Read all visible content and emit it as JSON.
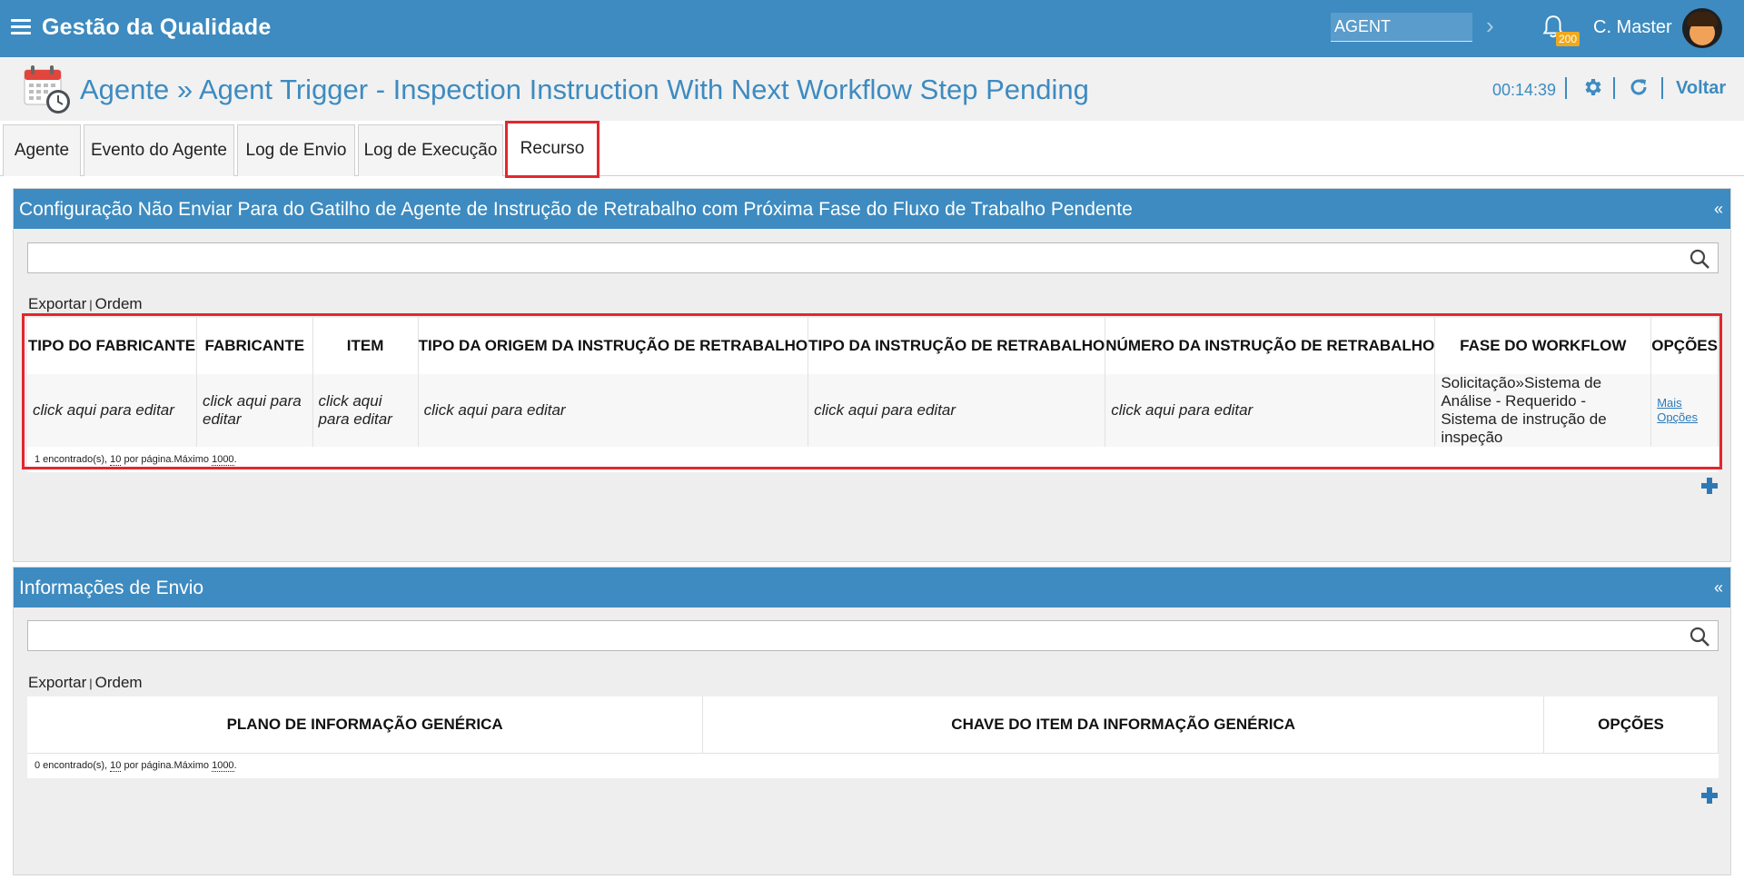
{
  "topbar": {
    "title": "Gestão da Qualidade",
    "module_value": "AGENT",
    "notification_count": "200",
    "user_name": "C. Master"
  },
  "title_row": {
    "page_title": "Agente » Agent Trigger - Inspection Instruction With Next Workflow Step Pending",
    "timer": "00:14:39",
    "back_label": "Voltar"
  },
  "tabs": [
    {
      "label": "Agente"
    },
    {
      "label": "Evento do Agente"
    },
    {
      "label": "Log de Envio"
    },
    {
      "label": "Log de Execução"
    },
    {
      "label": "Recurso",
      "active": true
    }
  ],
  "panel1": {
    "title": "Configuração Não Enviar Para do Gatilho de Agente de Instrução de Retrabalho com Próxima Fase do Fluxo de Trabalho Pendente",
    "collapse": "«",
    "search_value": "",
    "export_label": "Exportar",
    "order_label": "Ordem",
    "columns": [
      "TIPO DO FABRICANTE",
      "FABRICANTE",
      "ITEM",
      "TIPO DA ORIGEM DA INSTRUÇÃO DE RETRABALHO",
      "TIPO DA INSTRUÇÃO DE RETRABALHO",
      "NÚMERO DA INSTRUÇÃO DE RETRABALHO",
      "FASE DO WORKFLOW",
      "OPÇÕES"
    ],
    "row": {
      "tipo_fabricante": "click aqui para editar",
      "fabricante": "click aqui para editar",
      "item": "click aqui para editar",
      "tipo_origem": "click aqui para editar",
      "tipo_instrucao": "click aqui para editar",
      "numero_instrucao": "click aqui para editar",
      "fase_workflow": "Solicitação»Sistema de Análise - Requerido - Sistema de instrução de inspeção",
      "opt_more": "Mais",
      "opt_options": "Opções"
    },
    "footer": {
      "prefix": "1 encontrado(s), ",
      "per_page": "10",
      "mid": " por página.Máximo ",
      "max": "1000",
      "suffix": "."
    }
  },
  "panel2": {
    "title": "Informações de Envio",
    "collapse": "«",
    "search_value": "",
    "export_label": "Exportar",
    "order_label": "Ordem",
    "columns": [
      "PLANO DE INFORMAÇÃO GENÉRICA",
      "CHAVE DO ITEM DA INFORMAÇÃO GENÉRICA",
      "OPÇÕES"
    ],
    "footer": {
      "prefix": "0 encontrado(s), ",
      "per_page": "10",
      "mid": " por página.Máximo ",
      "max": "1000",
      "suffix": "."
    }
  },
  "colors": {
    "brand": "#3d8bc0",
    "highlight": "#e3272e",
    "badge": "#f0a91c"
  }
}
